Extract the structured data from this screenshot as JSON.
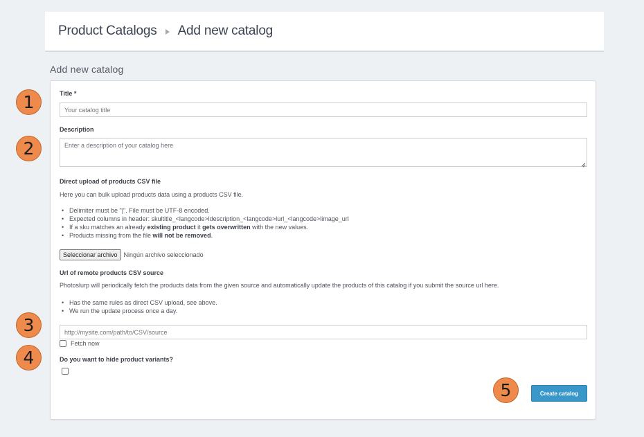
{
  "header": {
    "breadcrumb_root": "Product Catalogs",
    "breadcrumb_current": "Add new catalog"
  },
  "page": {
    "section_title": "Add new catalog"
  },
  "form": {
    "title_label": "Title *",
    "title_placeholder": "Your catalog title",
    "description_label": "Description",
    "description_placeholder": "Enter a description of your catalog here",
    "direct_upload": {
      "heading": "Direct upload of products CSV file",
      "intro": "Here you can bulk upload products data using a products CSV file.",
      "rule1": "Delimiter must be \"|\". File must be UTF-8 encoded.",
      "rule2": "Expected columns in header: skultitle_<langcode>ldescription_<langcode>lurl_<langcode>limage_url",
      "rule3_a": "If a sku matches an already ",
      "rule3_b": "existing product",
      "rule3_c": " it ",
      "rule3_d": "gets overwritten",
      "rule3_e": " with the new values.",
      "rule4_a": "Products missing from the file ",
      "rule4_b": "will not be removed",
      "rule4_c": ".",
      "file_button": "Seleccionar archivo",
      "file_status": "Ningún archivo seleccionado"
    },
    "remote": {
      "heading": "Url of remote products CSV source",
      "intro": "Photoslurp will periodically fetch the products data from the given source and automatically update the products of this catalog if you submit the source url here.",
      "rule1": "Has the same rules as direct CSV upload, see above.",
      "rule2": "We run the update process once a day.",
      "url_placeholder": "http://mysite.com/path/to/CSV/source",
      "fetch_now_label": "Fetch now",
      "fetch_now_checked": false
    },
    "variants_label": "Do you want to hide product variants?",
    "variants_checked": false,
    "submit_label": "Create catalog"
  },
  "markers": [
    "1",
    "2",
    "3",
    "4",
    "5"
  ],
  "colors": {
    "accent": "#3a97c9",
    "marker": "#ee8a4b",
    "background": "#eef1f4"
  }
}
